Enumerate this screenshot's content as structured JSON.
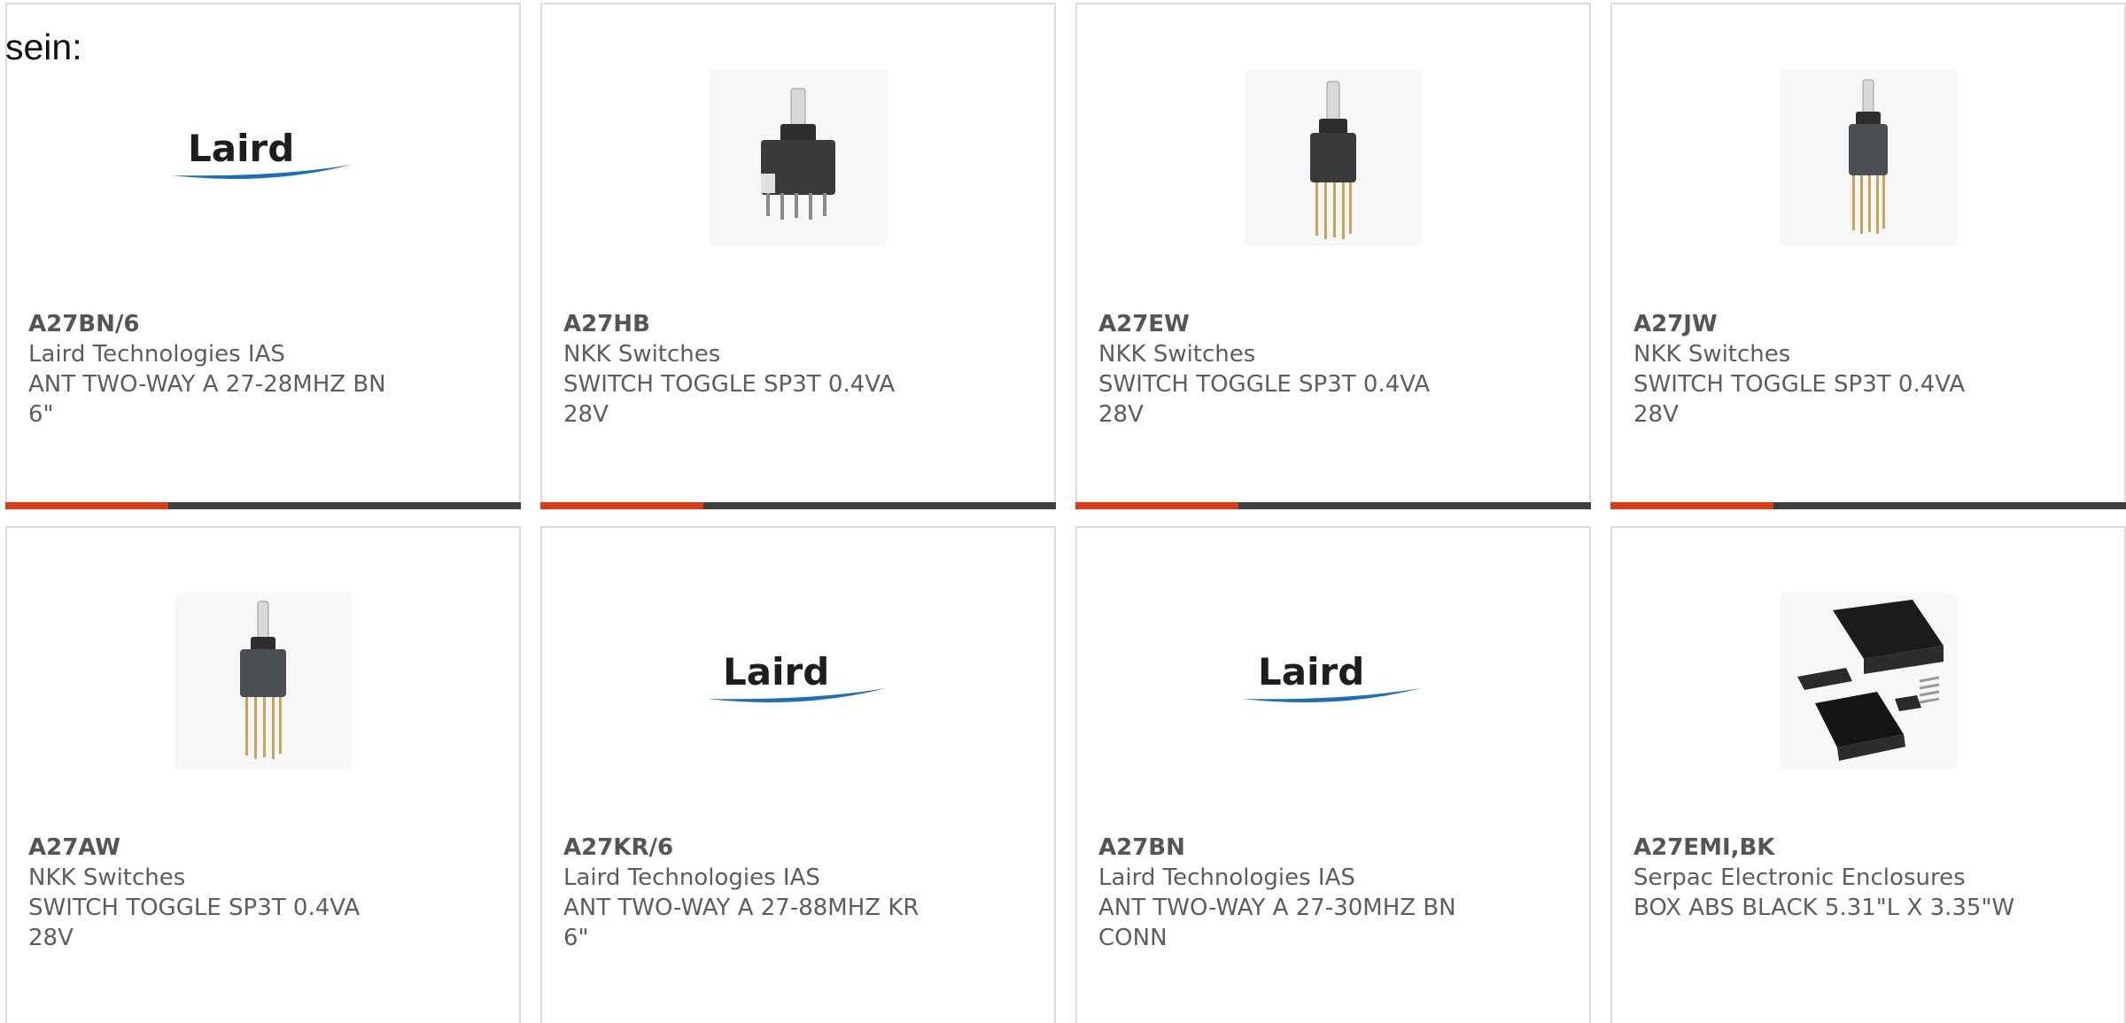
{
  "intro_text": "sein:",
  "colors": {
    "accent": "#e03a13",
    "bar": "#404040",
    "laird_blue": "#1a6fb5"
  },
  "products": [
    {
      "part_number": "A27BN/6",
      "manufacturer": "Laird Technologies IAS",
      "desc_line1": "ANT TWO-WAY A 27-28MHZ BN",
      "desc_line2": "6\"",
      "image": "laird-logo",
      "logo_text": "Laird"
    },
    {
      "part_number": "A27HB",
      "manufacturer": "NKK Switches",
      "desc_line1": "SWITCH TOGGLE SP3T 0.4VA",
      "desc_line2": "28V",
      "image": "toggle-switch-short-pins"
    },
    {
      "part_number": "A27EW",
      "manufacturer": "NKK Switches",
      "desc_line1": "SWITCH TOGGLE SP3T 0.4VA",
      "desc_line2": "28V",
      "image": "toggle-switch-long-pins"
    },
    {
      "part_number": "A27JW",
      "manufacturer": "NKK Switches",
      "desc_line1": "SWITCH TOGGLE SP3T 0.4VA",
      "desc_line2": "28V",
      "image": "toggle-switch-long-pins"
    },
    {
      "part_number": "A27AW",
      "manufacturer": "NKK Switches",
      "desc_line1": "SWITCH TOGGLE SP3T 0.4VA",
      "desc_line2": "28V",
      "image": "toggle-switch-long-pins"
    },
    {
      "part_number": "A27KR/6",
      "manufacturer": "Laird Technologies IAS",
      "desc_line1": "ANT TWO-WAY A 27-88MHZ KR",
      "desc_line2": "6\"",
      "image": "laird-logo",
      "logo_text": "Laird"
    },
    {
      "part_number": "A27BN",
      "manufacturer": "Laird Technologies IAS",
      "desc_line1": "ANT TWO-WAY A 27-30MHZ BN",
      "desc_line2": "CONN",
      "image": "laird-logo",
      "logo_text": "Laird"
    },
    {
      "part_number": "A27EMI,BK",
      "manufacturer": "Serpac Electronic Enclosures",
      "desc_line1": "BOX ABS BLACK 5.31\"L X 3.35\"W",
      "desc_line2": "",
      "image": "black-enclosure-box"
    }
  ]
}
